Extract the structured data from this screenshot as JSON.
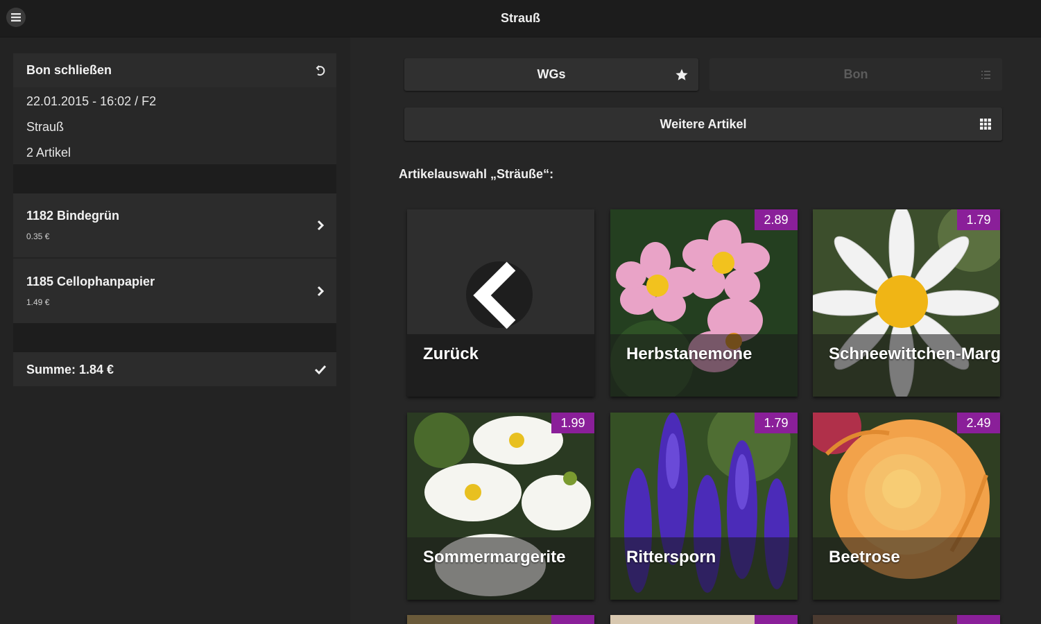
{
  "header": {
    "title": "Strauß"
  },
  "receipt": {
    "close_label": "Bon schließen",
    "datetime": "22.01.2015 - 16:02 / F2",
    "name": "Strauß",
    "count": "2 Artikel",
    "items": [
      {
        "name": "1182 Bindegrün",
        "price": "0.35 €"
      },
      {
        "name": "1185 Cellophanpapier",
        "price": "1.49 €"
      }
    ],
    "total_label": "Summe: 1.84 €"
  },
  "nav": {
    "wgs_label": "WGs",
    "bon_label": "Bon",
    "more_label": "Weitere Artikel"
  },
  "section_title": "Artikelauswahl „Sträuße“:",
  "tiles": [
    {
      "label": "Zurück",
      "price": ""
    },
    {
      "label": "Herbstanemone",
      "price": "2.89"
    },
    {
      "label": "Schneewittchen-Margerite",
      "price": "1.79"
    },
    {
      "label": "Sommermargerite",
      "price": "1.99"
    },
    {
      "label": "Rittersporn",
      "price": "1.79"
    },
    {
      "label": "Beetrose",
      "price": "2.49"
    }
  ],
  "colors": {
    "accent": "#8a1f99",
    "background": "#232323"
  }
}
